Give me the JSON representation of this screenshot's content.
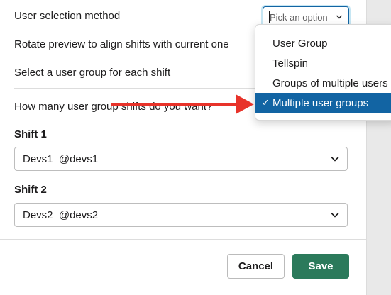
{
  "form": {
    "user_selection_label": "User selection method",
    "rotate_label": "Rotate preview to align shifts with current one",
    "select_group_label": "Select a user group for each shift",
    "how_many_label": "How many user group shifts do you want?"
  },
  "picker": {
    "placeholder": "Pick an option",
    "options": [
      {
        "label": "User Group",
        "selected": false
      },
      {
        "label": "Tellspin",
        "selected": false
      },
      {
        "label": "Groups of multiple users",
        "selected": false
      },
      {
        "label": "Multiple user groups",
        "selected": true
      }
    ],
    "check_glyph": "✓"
  },
  "shifts": [
    {
      "title": "Shift 1",
      "value": "Devs1  @devs1"
    },
    {
      "title": "Shift 2",
      "value": "Devs2  @devs2"
    }
  ],
  "footer": {
    "cancel_label": "Cancel",
    "save_label": "Save"
  },
  "colors": {
    "accent": "#1264a3",
    "save": "#2b7a5b",
    "annotation_arrow": "#e8332a"
  }
}
